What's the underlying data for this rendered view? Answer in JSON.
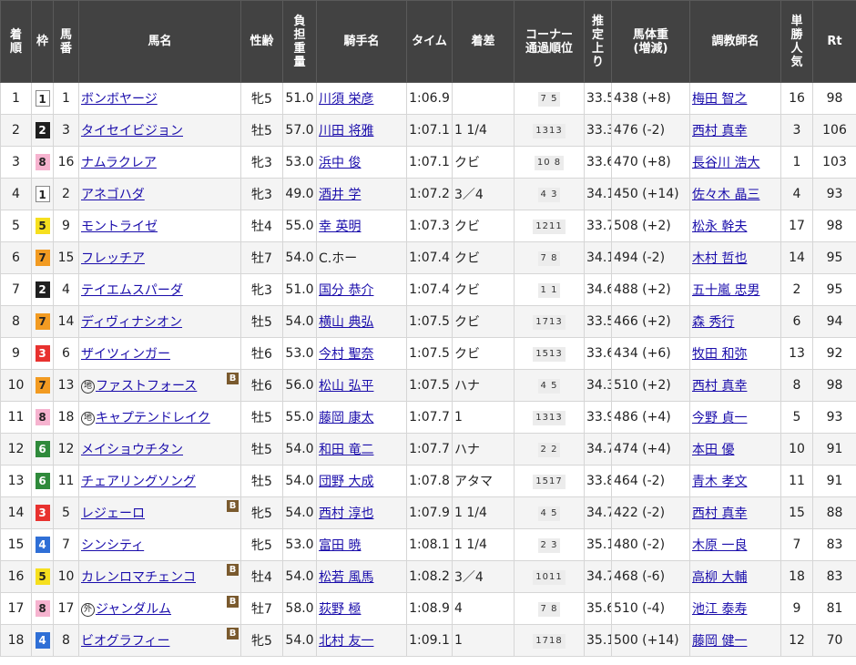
{
  "columns": [
    {
      "key": "rank",
      "label": "着順"
    },
    {
      "key": "waku",
      "label": "枠"
    },
    {
      "key": "num",
      "label": "馬番"
    },
    {
      "key": "horse",
      "label": "馬名"
    },
    {
      "key": "sexage",
      "label": "性齢"
    },
    {
      "key": "weight",
      "label": "負担重量"
    },
    {
      "key": "jockey",
      "label": "騎手名"
    },
    {
      "key": "time",
      "label": "タイム"
    },
    {
      "key": "margin",
      "label": "着差"
    },
    {
      "key": "corner",
      "label": "コーナー通過順位"
    },
    {
      "key": "last3f",
      "label": "推定上り"
    },
    {
      "key": "body",
      "label": "馬体重(増減)"
    },
    {
      "key": "trainer",
      "label": "調教師名"
    },
    {
      "key": "pop",
      "label": "単勝人気"
    },
    {
      "key": "rt",
      "label": "Rt"
    }
  ],
  "rows": [
    {
      "rank": "1",
      "waku": "1",
      "num": "1",
      "mark": "",
      "horse": "ボンボヤージ",
      "blinker": false,
      "sexage": "牝5",
      "weight": "51.0",
      "jockey": "川須 栄彦",
      "time": "1:06.9",
      "margin": "",
      "corner": "7 5",
      "last3f": "33.5",
      "body": "438 (+8)",
      "trainer": "梅田 智之",
      "pop": "16",
      "rt": "98"
    },
    {
      "rank": "2",
      "waku": "2",
      "num": "3",
      "mark": "",
      "horse": "タイセイビジョン",
      "blinker": false,
      "sexage": "牡5",
      "weight": "57.0",
      "jockey": "川田 将雅",
      "time": "1:07.1",
      "margin": "1 1/4",
      "corner": "1313",
      "last3f": "33.3",
      "body": "476 (-2)",
      "trainer": "西村 真幸",
      "pop": "3",
      "rt": "106"
    },
    {
      "rank": "3",
      "waku": "8",
      "num": "16",
      "mark": "",
      "horse": "ナムラクレア",
      "blinker": false,
      "sexage": "牝3",
      "weight": "53.0",
      "jockey": "浜中 俊",
      "time": "1:07.1",
      "margin": "クビ",
      "corner": "10 8",
      "last3f": "33.6",
      "body": "470 (+8)",
      "trainer": "長谷川 浩大",
      "pop": "1",
      "rt": "103"
    },
    {
      "rank": "4",
      "waku": "1",
      "num": "2",
      "mark": "",
      "horse": "アネゴハダ",
      "blinker": false,
      "sexage": "牝3",
      "weight": "49.0",
      "jockey": "酒井 学",
      "time": "1:07.2",
      "margin": "3／4",
      "corner": "4 3",
      "last3f": "34.1",
      "body": "450 (+14)",
      "trainer": "佐々木 晶三",
      "pop": "4",
      "rt": "93"
    },
    {
      "rank": "5",
      "waku": "5",
      "num": "9",
      "mark": "",
      "horse": "モントライゼ",
      "blinker": false,
      "sexage": "牡4",
      "weight": "55.0",
      "jockey": "幸 英明",
      "time": "1:07.3",
      "margin": "クビ",
      "corner": "1211",
      "last3f": "33.7",
      "body": "508 (+2)",
      "trainer": "松永 幹夫",
      "pop": "17",
      "rt": "98"
    },
    {
      "rank": "6",
      "waku": "7",
      "num": "15",
      "mark": "",
      "horse": "フレッチア",
      "blinker": false,
      "sexage": "牡7",
      "weight": "54.0",
      "jockey": "C.ホー",
      "time": "1:07.4",
      "margin": "クビ",
      "corner": "7 8",
      "last3f": "34.1",
      "body": "494 (-2)",
      "trainer": "木村 哲也",
      "pop": "14",
      "rt": "95"
    },
    {
      "rank": "7",
      "waku": "2",
      "num": "4",
      "mark": "",
      "horse": "テイエムスパーダ",
      "blinker": false,
      "sexage": "牝3",
      "weight": "51.0",
      "jockey": "国分 恭介",
      "time": "1:07.4",
      "margin": "クビ",
      "corner": "1 1",
      "last3f": "34.6",
      "body": "488 (+2)",
      "trainer": "五十嵐 忠男",
      "pop": "2",
      "rt": "95"
    },
    {
      "rank": "8",
      "waku": "7",
      "num": "14",
      "mark": "",
      "horse": "ディヴィナシオン",
      "blinker": false,
      "sexage": "牡5",
      "weight": "54.0",
      "jockey": "横山 典弘",
      "time": "1:07.5",
      "margin": "クビ",
      "corner": "1713",
      "last3f": "33.5",
      "body": "466 (+2)",
      "trainer": "森 秀行",
      "pop": "6",
      "rt": "94"
    },
    {
      "rank": "9",
      "waku": "3",
      "num": "6",
      "mark": "",
      "horse": "ザイツィンガー",
      "blinker": false,
      "sexage": "牡6",
      "weight": "53.0",
      "jockey": "今村 聖奈",
      "time": "1:07.5",
      "margin": "クビ",
      "corner": "1513",
      "last3f": "33.6",
      "body": "434 (+6)",
      "trainer": "牧田 和弥",
      "pop": "13",
      "rt": "92"
    },
    {
      "rank": "10",
      "waku": "7",
      "num": "13",
      "mark": "地",
      "horse": "ファストフォース",
      "blinker": true,
      "sexage": "牡6",
      "weight": "56.0",
      "jockey": "松山 弘平",
      "time": "1:07.5",
      "margin": "ハナ",
      "corner": "4 5",
      "last3f": "34.3",
      "body": "510 (+2)",
      "trainer": "西村 真幸",
      "pop": "8",
      "rt": "98"
    },
    {
      "rank": "11",
      "waku": "8",
      "num": "18",
      "mark": "地",
      "horse": "キャプテンドレイク",
      "blinker": false,
      "sexage": "牡5",
      "weight": "55.0",
      "jockey": "藤岡 康太",
      "time": "1:07.7",
      "margin": "1",
      "corner": "1313",
      "last3f": "33.9",
      "body": "486 (+4)",
      "trainer": "今野 貞一",
      "pop": "5",
      "rt": "93"
    },
    {
      "rank": "12",
      "waku": "6",
      "num": "12",
      "mark": "",
      "horse": "メイショウチタン",
      "blinker": false,
      "sexage": "牡5",
      "weight": "54.0",
      "jockey": "和田 竜二",
      "time": "1:07.7",
      "margin": "ハナ",
      "corner": "2 2",
      "last3f": "34.7",
      "body": "474 (+4)",
      "trainer": "本田 優",
      "pop": "10",
      "rt": "91"
    },
    {
      "rank": "13",
      "waku": "6",
      "num": "11",
      "mark": "",
      "horse": "チェアリングソング",
      "blinker": false,
      "sexage": "牡5",
      "weight": "54.0",
      "jockey": "団野 大成",
      "time": "1:07.8",
      "margin": "アタマ",
      "corner": "1517",
      "last3f": "33.8",
      "body": "464 (-2)",
      "trainer": "青木 孝文",
      "pop": "11",
      "rt": "91"
    },
    {
      "rank": "14",
      "waku": "3",
      "num": "5",
      "mark": "",
      "horse": "レジェーロ",
      "blinker": true,
      "sexage": "牝5",
      "weight": "54.0",
      "jockey": "西村 淳也",
      "time": "1:07.9",
      "margin": "1 1/4",
      "corner": "4 5",
      "last3f": "34.7",
      "body": "422 (-2)",
      "trainer": "西村 真幸",
      "pop": "15",
      "rt": "88"
    },
    {
      "rank": "15",
      "waku": "4",
      "num": "7",
      "mark": "",
      "horse": "シンシティ",
      "blinker": false,
      "sexage": "牝5",
      "weight": "53.0",
      "jockey": "富田 暁",
      "time": "1:08.1",
      "margin": "1 1/4",
      "corner": "2 3",
      "last3f": "35.1",
      "body": "480 (-2)",
      "trainer": "木原 一良",
      "pop": "7",
      "rt": "83"
    },
    {
      "rank": "16",
      "waku": "5",
      "num": "10",
      "mark": "",
      "horse": "カレンロマチェンコ",
      "blinker": true,
      "sexage": "牡4",
      "weight": "54.0",
      "jockey": "松若 風馬",
      "time": "1:08.2",
      "margin": "3／4",
      "corner": "1011",
      "last3f": "34.7",
      "body": "468 (-6)",
      "trainer": "高柳 大輔",
      "pop": "18",
      "rt": "83"
    },
    {
      "rank": "17",
      "waku": "8",
      "num": "17",
      "mark": "外",
      "horse": "ジャンダルム",
      "blinker": true,
      "sexage": "牡7",
      "weight": "58.0",
      "jockey": "荻野 極",
      "time": "1:08.9",
      "margin": "4",
      "corner": "7 8",
      "last3f": "35.6",
      "body": "510 (-4)",
      "trainer": "池江 泰寿",
      "pop": "9",
      "rt": "81"
    },
    {
      "rank": "18",
      "waku": "4",
      "num": "8",
      "mark": "",
      "horse": "ビオグラフィー",
      "blinker": true,
      "sexage": "牝5",
      "weight": "54.0",
      "jockey": "北村 友一",
      "time": "1:09.1",
      "margin": "1",
      "corner": "1718",
      "last3f": "35.1",
      "body": "500 (+14)",
      "trainer": "藤岡 健一",
      "pop": "12",
      "rt": "70"
    }
  ],
  "blinker_label": "B",
  "colors": {
    "header_bg": "#424242",
    "link": "#1a0dab",
    "row_alt": "#f4f4f4"
  }
}
